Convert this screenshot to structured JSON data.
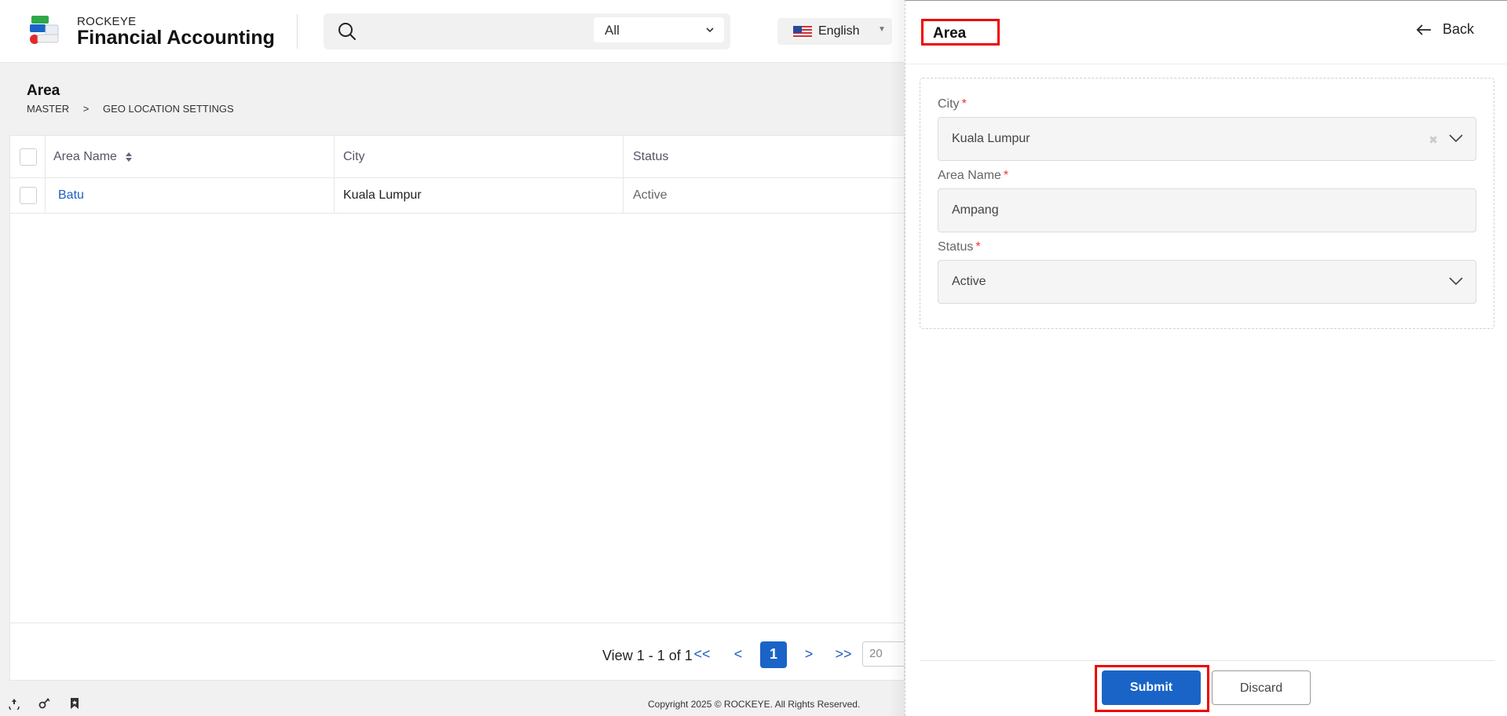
{
  "header": {
    "brand_small": "ROCKEYE",
    "brand_big": "Financial Accounting",
    "search": {
      "placeholder": "",
      "filter_value": "All"
    },
    "language": "English"
  },
  "page": {
    "title": "Area",
    "breadcrumb": [
      "MASTER",
      ">",
      "GEO LOCATION SETTINGS"
    ]
  },
  "table": {
    "columns": [
      "Area Name",
      "City",
      "Status"
    ],
    "rows": [
      {
        "area_name": "Batu",
        "city": "Kuala Lumpur",
        "status": "Active"
      }
    ],
    "pager": {
      "summary": "View 1 - 1 of 1",
      "first": "<<",
      "prev": "<",
      "current": "1",
      "next": ">",
      "last": ">>",
      "page_size": "20"
    }
  },
  "footer": {
    "copyright": "Copyright 2025 © ROCKEYE. All Rights Reserved.",
    "icons": [
      "recycle-icon",
      "settings-icon",
      "bookmark-icon"
    ]
  },
  "panel": {
    "title": "Area",
    "back_label": "Back",
    "fields": {
      "city": {
        "label": "City",
        "value": "Kuala Lumpur"
      },
      "area_name": {
        "label": "Area Name",
        "value": "Ampang"
      },
      "status": {
        "label": "Status",
        "value": "Active"
      }
    },
    "required_mark": "*",
    "submit_label": "Submit",
    "discard_label": "Discard"
  },
  "colors": {
    "primary": "#1a64c8",
    "link": "#1f5fbf",
    "highlight": "#ee0000",
    "required": "#ee3333"
  }
}
